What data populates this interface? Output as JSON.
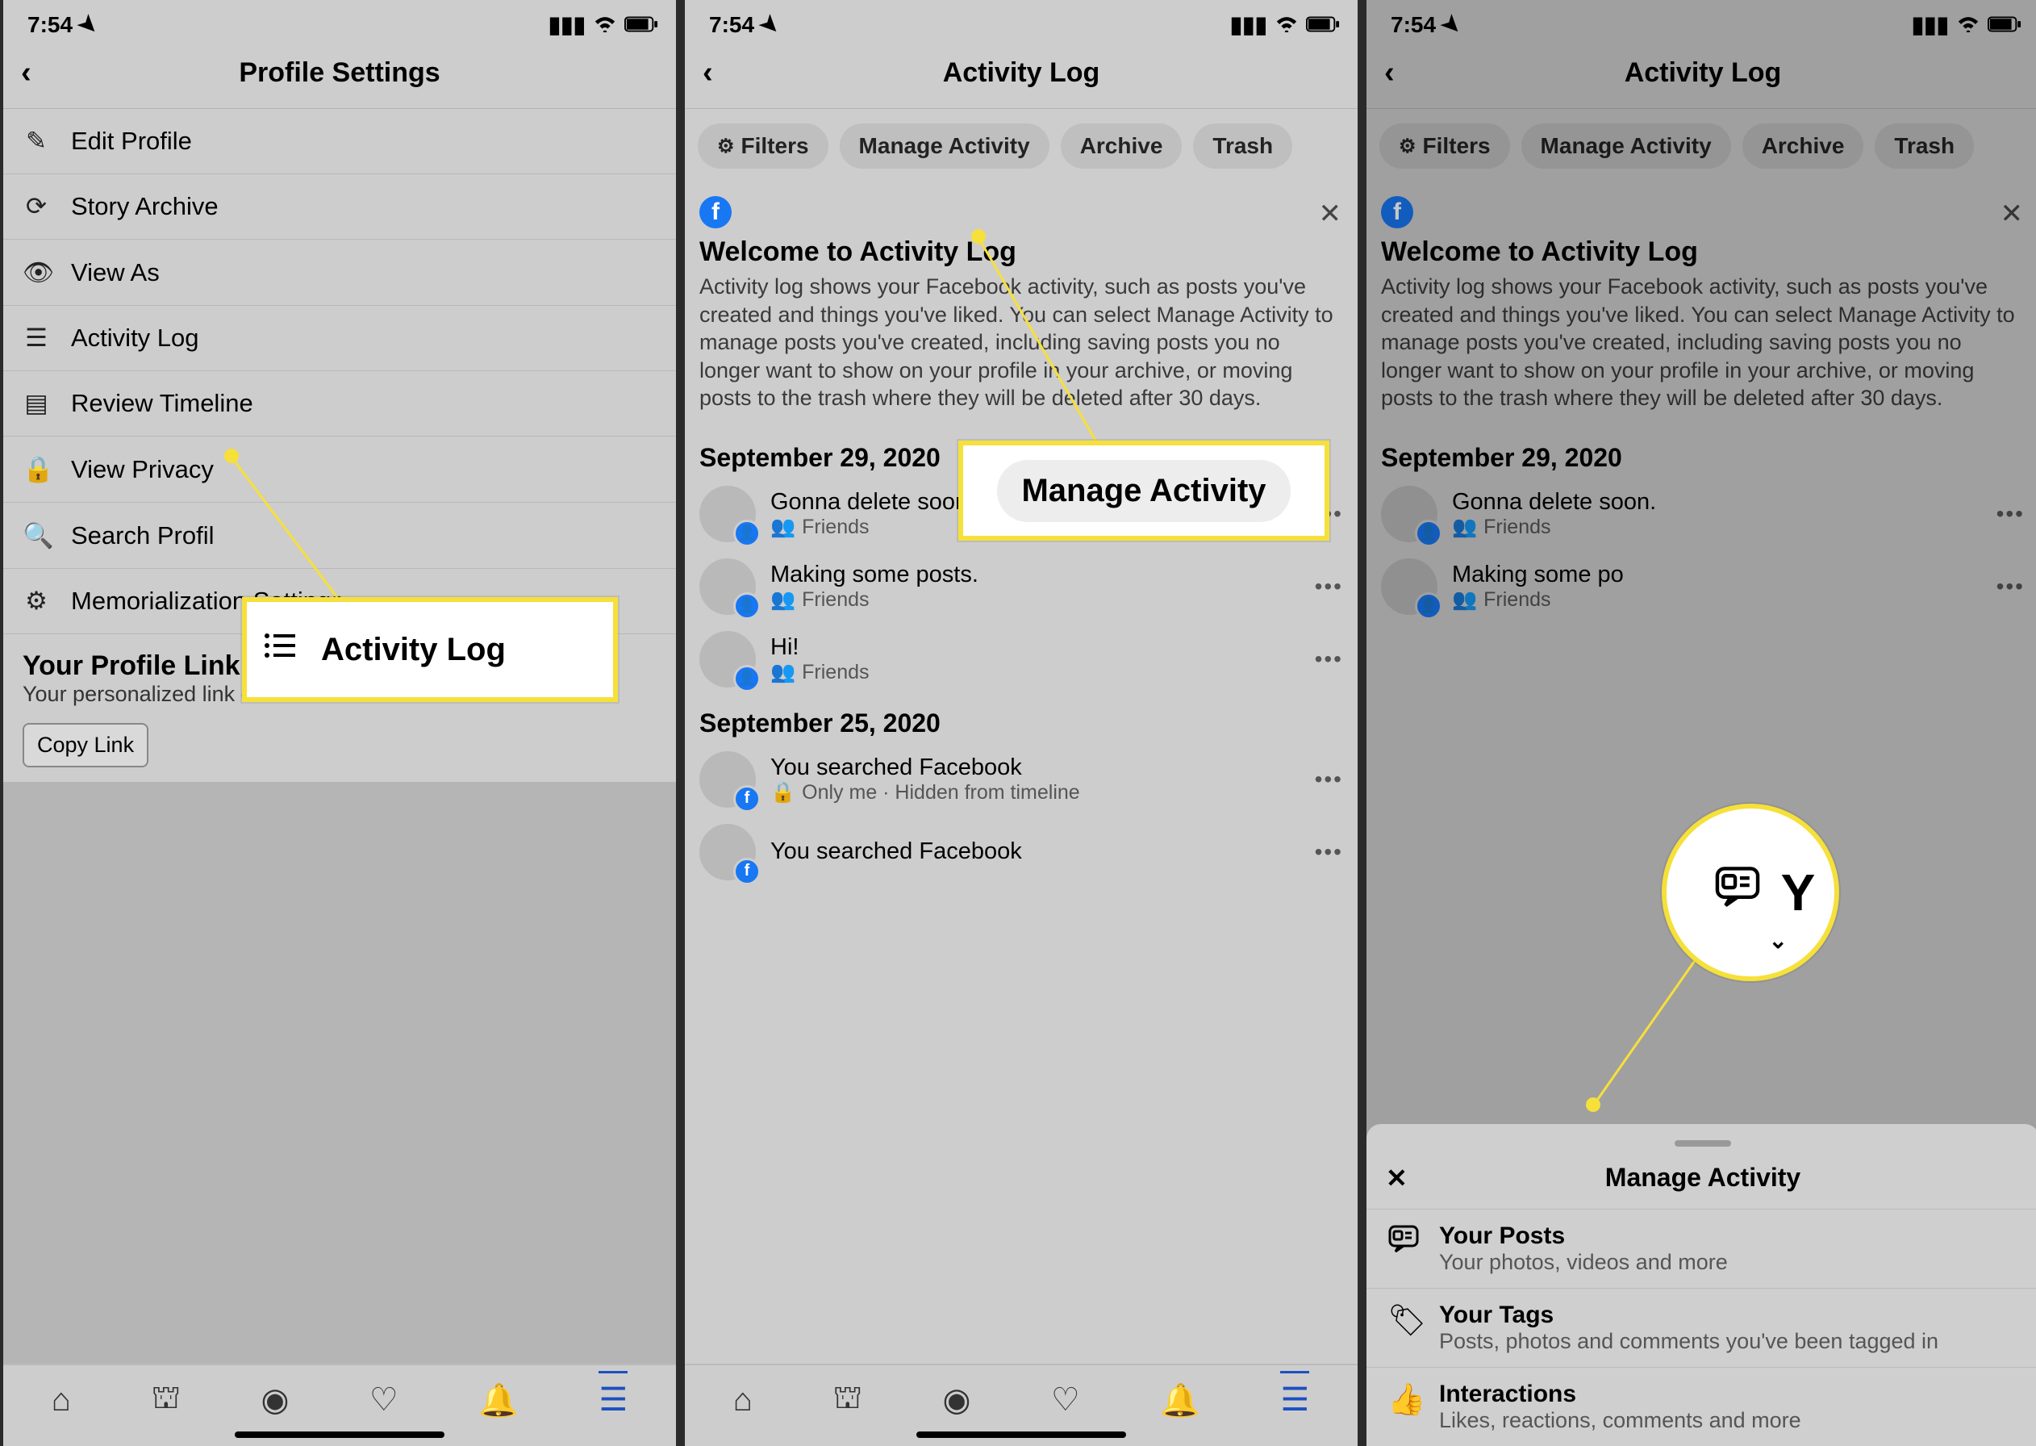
{
  "status": {
    "time": "7:54",
    "location_icon": "➤"
  },
  "screen1": {
    "header_title": "Profile Settings",
    "rows": [
      {
        "icon": "✎",
        "label": "Edit Profile"
      },
      {
        "icon": "⟳",
        "label": "Story Archive"
      },
      {
        "icon": "👁",
        "label": "View As"
      },
      {
        "icon": "☰",
        "label": "Activity Log"
      },
      {
        "icon": "▤",
        "label": "Review Timeline"
      },
      {
        "icon": "🔒",
        "label": "View Privacy"
      },
      {
        "icon": "🔍",
        "label": "Search Profil"
      },
      {
        "icon": "⚙",
        "label": "Memorialization Settings"
      }
    ],
    "profile_link_title": "Your Profile Link",
    "profile_link_sub": "Your personalized link on Facebook.",
    "copy_link": "Copy Link"
  },
  "callout1_label": "Activity Log",
  "screen2": {
    "header_title": "Activity Log",
    "chips": [
      "Filters",
      "Manage Activity",
      "Archive",
      "Trash"
    ],
    "welcome_title": "Welcome to Activity Log",
    "welcome_body": "Activity log shows your Facebook activity, such as posts you've created and things you've liked. You can select Manage Activity to manage posts you've created, including saving posts you no longer want to show on your profile in your archive, or moving posts to the trash where they will be deleted after 30 days.",
    "groups": [
      {
        "date": "September 29, 2020",
        "items": [
          {
            "text": "Gonna delete soon.",
            "audience": "Friends",
            "badge": "person"
          },
          {
            "text": "Making some posts.",
            "audience": "Friends",
            "badge": "person"
          },
          {
            "text": "Hi!",
            "audience": "Friends",
            "badge": "person"
          }
        ]
      },
      {
        "date": "September 25, 2020",
        "items": [
          {
            "text": "You searched Facebook",
            "audience": "Only me · Hidden from timeline",
            "badge": "fb"
          },
          {
            "text": "You searched Facebook",
            "audience": "",
            "badge": "fb"
          }
        ]
      }
    ]
  },
  "callout2_label": "Manage Activity",
  "screen3": {
    "header_title": "Activity Log",
    "chips": [
      "Filters",
      "Manage Activity",
      "Archive",
      "Trash"
    ],
    "welcome_title": "Welcome to Activity Log",
    "welcome_body": "Activity log shows your Facebook activity, such as posts you've created and things you've liked. You can select Manage Activity to manage posts you've created, including saving posts you no longer want to show on your profile in your archive, or moving posts to the trash where they will be deleted after 30 days.",
    "date": "September 29, 2020",
    "items": [
      {
        "text": "Gonna delete soon.",
        "audience": "Friends"
      },
      {
        "text": "Making some po",
        "audience": "Friends"
      }
    ],
    "sheet_title": "Manage Activity",
    "sheet_rows": [
      {
        "icon": "▣",
        "title": "Your Posts",
        "sub": "Your photos, videos and more"
      },
      {
        "icon": "🏷",
        "title": "Your Tags",
        "sub": "Posts, photos and comments you've been tagged in"
      },
      {
        "icon": "👍",
        "title": "Interactions",
        "sub": "Likes, reactions, comments and more"
      }
    ]
  },
  "callout3_letter": "Y"
}
